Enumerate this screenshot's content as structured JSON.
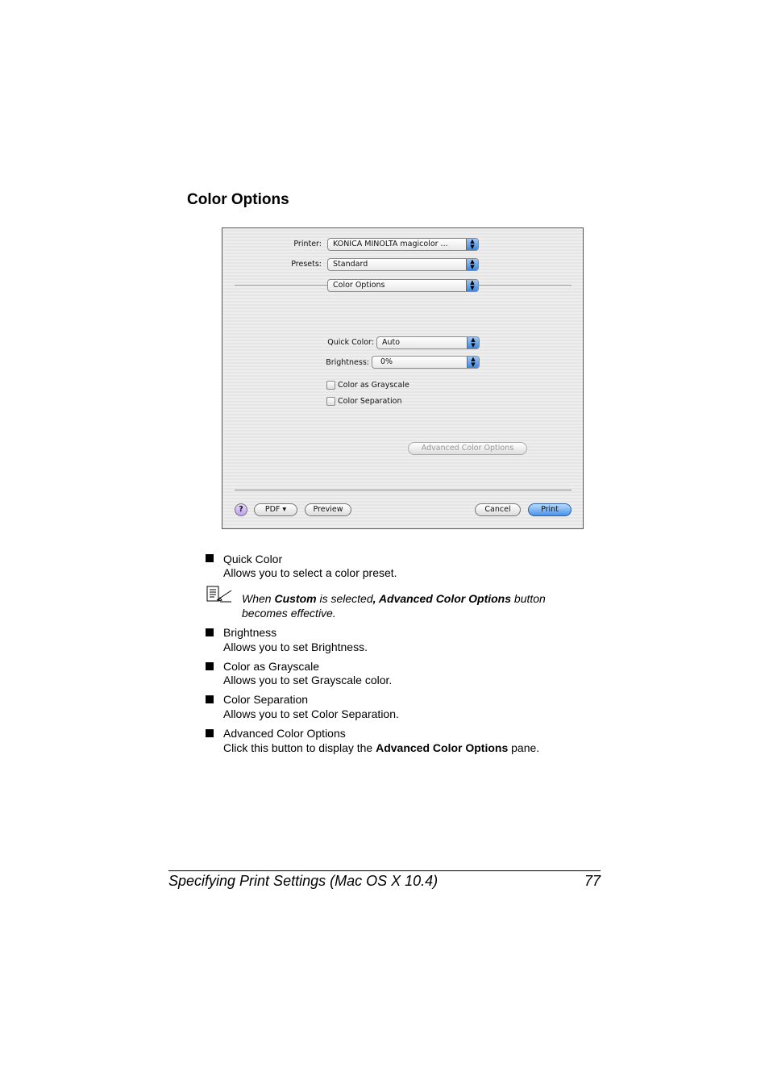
{
  "heading": "Color Options",
  "dialog": {
    "printer_label": "Printer:",
    "printer_value": "KONICA MINOLTA magicolor ...",
    "presets_label": "Presets:",
    "presets_value": "Standard",
    "pane_value": "Color Options",
    "quick_color_label": "Quick Color:",
    "quick_color_value": "Auto",
    "brightness_label": "Brightness:",
    "brightness_value": "0%",
    "grayscale_label": "Color as Grayscale",
    "grayscale_checked": false,
    "separation_label": "Color Separation",
    "separation_checked": false,
    "advanced_button": "Advanced Color Options",
    "help_button": "?",
    "pdf_button": "PDF ▾",
    "preview_button": "Preview",
    "cancel_button": "Cancel",
    "print_button": "Print",
    "accent_color": "#3f86e0"
  },
  "items": [
    {
      "title": "Quick Color",
      "desc": "Allows you to select a color preset."
    },
    {
      "title": "Brightness",
      "desc": "Allows you to set Brightness."
    },
    {
      "title": "Color as Grayscale",
      "desc": "Allows you to set Grayscale color."
    },
    {
      "title": "Color Separation",
      "desc": "Allows you to set Color Separation."
    },
    {
      "title": "Advanced Color Options",
      "desc_pre": "Click this button to display the ",
      "desc_bold": "Advanced Color Options",
      "desc_post": " pane."
    }
  ],
  "note": {
    "p1": "When ",
    "b1": "Custom",
    "p2": " is selected",
    "b2": ", Advanced Color Options",
    "p3": " button",
    "line2": "becomes effective."
  },
  "footer": {
    "title": "Specifying Print Settings (Mac OS X 10.4)",
    "page": "77"
  }
}
